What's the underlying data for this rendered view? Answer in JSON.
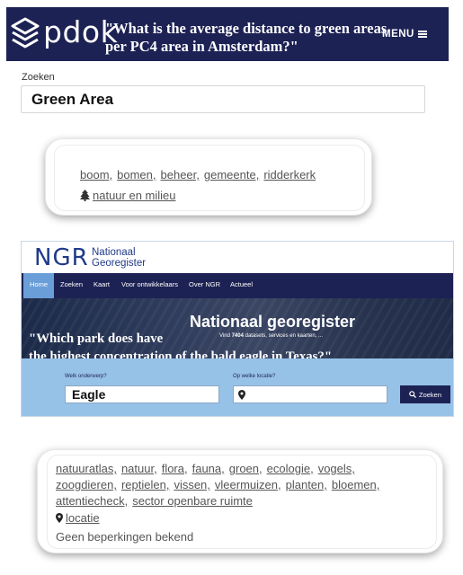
{
  "pdok": {
    "logo_text": "pdok",
    "question": "\"What is the average distance to green areas per PC4 area in Amsterdam?\"",
    "menu_label": "MENU",
    "search_label": "Zoeken",
    "search_value": "Green Area",
    "colors": {
      "header_bg": "#1d2254"
    }
  },
  "result1": {
    "tags": [
      "boom,",
      "bomen,",
      "beheer,",
      "gemeente,",
      "ridderkerk"
    ],
    "category": "natuur en milieu",
    "category_icon": "tree-icon"
  },
  "ngr": {
    "logo_mark": "NGR",
    "name_line1": "Nationaal",
    "name_line2": "Georegister",
    "nav": [
      "Home",
      "Zoeken",
      "Kaart",
      "Voor ontwikkelaars",
      "Over NGR",
      "Actueel"
    ],
    "hero_title": "Nationaal georegister",
    "hero_sub_prefix": "Vind",
    "hero_sub_count": "7404",
    "hero_sub_suffix": "datasets, services en kaarten, ...",
    "question_line1": "\"Which park does have",
    "question_line2": "the highest concentration of the bald eagle in Texas?\"",
    "subject_label": "Welk onderwerp?",
    "subject_value": "Eagle",
    "location_label": "Op welke locatie?",
    "location_icon": "map-marker-icon",
    "search_button": "Zoeken",
    "colors": {
      "nav_bg": "#1d2254",
      "nav_active": "#6a9ed8",
      "search_band": "#97c2e8"
    }
  },
  "result2": {
    "tags": [
      "natuuratlas,",
      "natuur,",
      "flora,",
      "fauna,",
      "groen,",
      "ecologie,",
      "vogels,",
      "zoogdieren,",
      "reptielen,",
      "vissen,",
      "vleermuizen,",
      "planten,",
      "bloemen,",
      "attentiecheck,",
      "sector openbare ruimte"
    ],
    "category": "locatie",
    "category_icon": "map-marker-icon",
    "note": "Geen beperkingen bekend"
  }
}
